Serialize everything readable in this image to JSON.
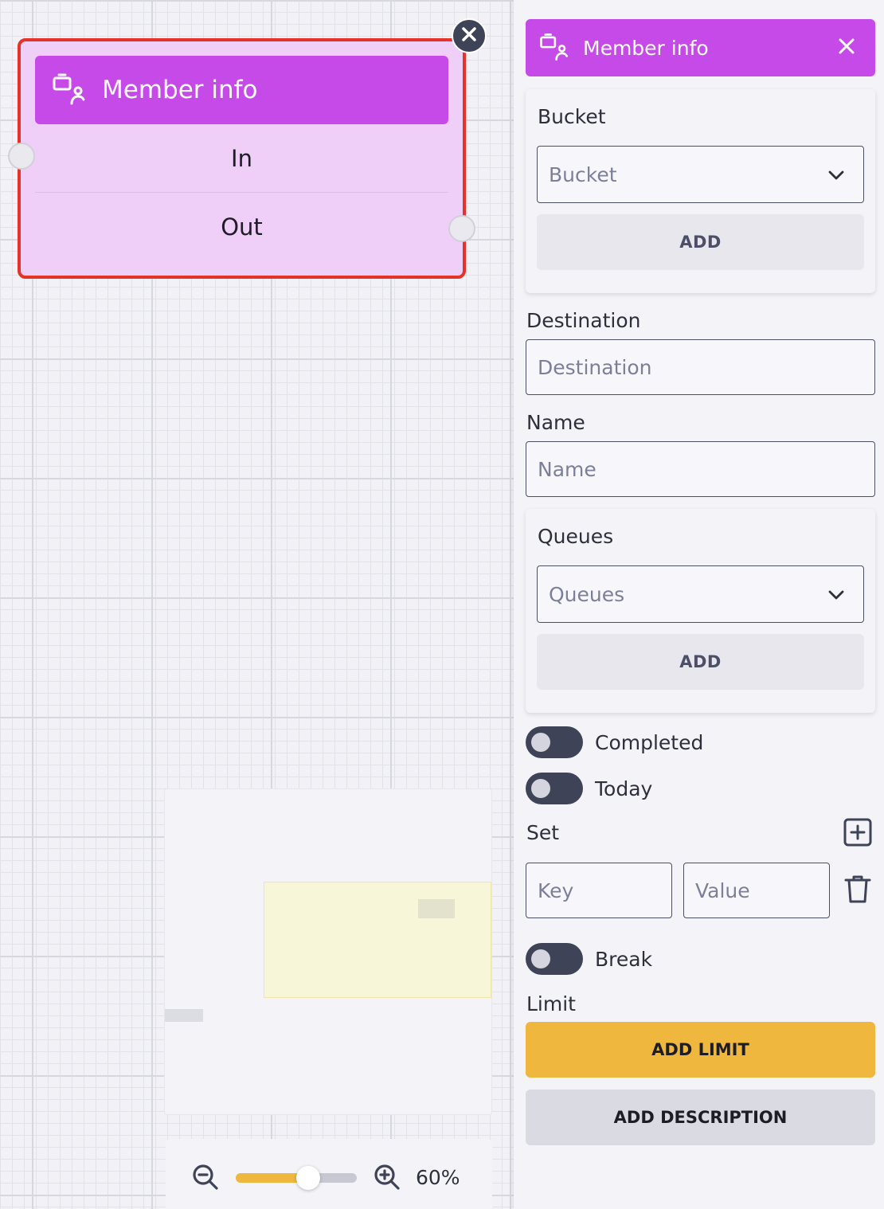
{
  "node": {
    "title": "Member info",
    "in_label": "In",
    "out_label": "Out"
  },
  "zoom": {
    "value_label": "60%",
    "level": 0.6
  },
  "panel": {
    "title": "Member info",
    "bucket": {
      "label": "Bucket",
      "placeholder": "Bucket",
      "add_label": "ADD"
    },
    "destination": {
      "label": "Destination",
      "placeholder": "Destination"
    },
    "name": {
      "label": "Name",
      "placeholder": "Name"
    },
    "queues": {
      "label": "Queues",
      "placeholder": "Queues",
      "add_label": "ADD"
    },
    "toggles": {
      "completed": "Completed",
      "today": "Today",
      "break": "Break"
    },
    "set": {
      "label": "Set",
      "key_placeholder": "Key",
      "value_placeholder": "Value"
    },
    "limit": {
      "label": "Limit",
      "add_limit_label": "ADD LIMIT"
    },
    "add_description_label": "ADD DESCRIPTION"
  },
  "colors": {
    "accent_purple": "#c64ae8",
    "node_bg": "#efcff7",
    "node_border": "#e5332a",
    "limit_button": "#efb73e",
    "dark": "#3e4357"
  }
}
